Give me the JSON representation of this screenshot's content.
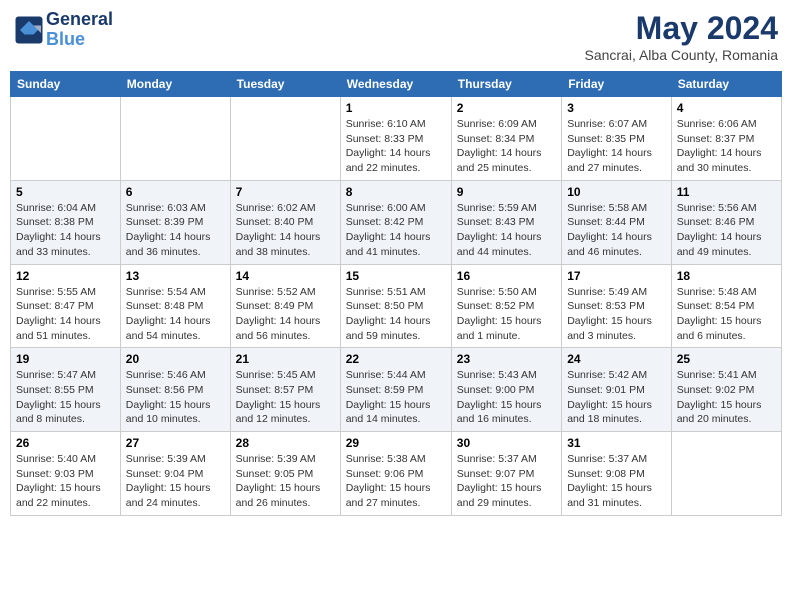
{
  "header": {
    "logo_line1": "General",
    "logo_line2": "Blue",
    "month_year": "May 2024",
    "location": "Sancrai, Alba County, Romania"
  },
  "days_of_week": [
    "Sunday",
    "Monday",
    "Tuesday",
    "Wednesday",
    "Thursday",
    "Friday",
    "Saturday"
  ],
  "weeks": [
    [
      null,
      null,
      null,
      {
        "day": "1",
        "sunrise": "6:10 AM",
        "sunset": "8:33 PM",
        "daylight": "14 hours and 22 minutes."
      },
      {
        "day": "2",
        "sunrise": "6:09 AM",
        "sunset": "8:34 PM",
        "daylight": "14 hours and 25 minutes."
      },
      {
        "day": "3",
        "sunrise": "6:07 AM",
        "sunset": "8:35 PM",
        "daylight": "14 hours and 27 minutes."
      },
      {
        "day": "4",
        "sunrise": "6:06 AM",
        "sunset": "8:37 PM",
        "daylight": "14 hours and 30 minutes."
      }
    ],
    [
      {
        "day": "5",
        "sunrise": "6:04 AM",
        "sunset": "8:38 PM",
        "daylight": "14 hours and 33 minutes."
      },
      {
        "day": "6",
        "sunrise": "6:03 AM",
        "sunset": "8:39 PM",
        "daylight": "14 hours and 36 minutes."
      },
      {
        "day": "7",
        "sunrise": "6:02 AM",
        "sunset": "8:40 PM",
        "daylight": "14 hours and 38 minutes."
      },
      {
        "day": "8",
        "sunrise": "6:00 AM",
        "sunset": "8:42 PM",
        "daylight": "14 hours and 41 minutes."
      },
      {
        "day": "9",
        "sunrise": "5:59 AM",
        "sunset": "8:43 PM",
        "daylight": "14 hours and 44 minutes."
      },
      {
        "day": "10",
        "sunrise": "5:58 AM",
        "sunset": "8:44 PM",
        "daylight": "14 hours and 46 minutes."
      },
      {
        "day": "11",
        "sunrise": "5:56 AM",
        "sunset": "8:46 PM",
        "daylight": "14 hours and 49 minutes."
      }
    ],
    [
      {
        "day": "12",
        "sunrise": "5:55 AM",
        "sunset": "8:47 PM",
        "daylight": "14 hours and 51 minutes."
      },
      {
        "day": "13",
        "sunrise": "5:54 AM",
        "sunset": "8:48 PM",
        "daylight": "14 hours and 54 minutes."
      },
      {
        "day": "14",
        "sunrise": "5:52 AM",
        "sunset": "8:49 PM",
        "daylight": "14 hours and 56 minutes."
      },
      {
        "day": "15",
        "sunrise": "5:51 AM",
        "sunset": "8:50 PM",
        "daylight": "14 hours and 59 minutes."
      },
      {
        "day": "16",
        "sunrise": "5:50 AM",
        "sunset": "8:52 PM",
        "daylight": "15 hours and 1 minute."
      },
      {
        "day": "17",
        "sunrise": "5:49 AM",
        "sunset": "8:53 PM",
        "daylight": "15 hours and 3 minutes."
      },
      {
        "day": "18",
        "sunrise": "5:48 AM",
        "sunset": "8:54 PM",
        "daylight": "15 hours and 6 minutes."
      }
    ],
    [
      {
        "day": "19",
        "sunrise": "5:47 AM",
        "sunset": "8:55 PM",
        "daylight": "15 hours and 8 minutes."
      },
      {
        "day": "20",
        "sunrise": "5:46 AM",
        "sunset": "8:56 PM",
        "daylight": "15 hours and 10 minutes."
      },
      {
        "day": "21",
        "sunrise": "5:45 AM",
        "sunset": "8:57 PM",
        "daylight": "15 hours and 12 minutes."
      },
      {
        "day": "22",
        "sunrise": "5:44 AM",
        "sunset": "8:59 PM",
        "daylight": "15 hours and 14 minutes."
      },
      {
        "day": "23",
        "sunrise": "5:43 AM",
        "sunset": "9:00 PM",
        "daylight": "15 hours and 16 minutes."
      },
      {
        "day": "24",
        "sunrise": "5:42 AM",
        "sunset": "9:01 PM",
        "daylight": "15 hours and 18 minutes."
      },
      {
        "day": "25",
        "sunrise": "5:41 AM",
        "sunset": "9:02 PM",
        "daylight": "15 hours and 20 minutes."
      }
    ],
    [
      {
        "day": "26",
        "sunrise": "5:40 AM",
        "sunset": "9:03 PM",
        "daylight": "15 hours and 22 minutes."
      },
      {
        "day": "27",
        "sunrise": "5:39 AM",
        "sunset": "9:04 PM",
        "daylight": "15 hours and 24 minutes."
      },
      {
        "day": "28",
        "sunrise": "5:39 AM",
        "sunset": "9:05 PM",
        "daylight": "15 hours and 26 minutes."
      },
      {
        "day": "29",
        "sunrise": "5:38 AM",
        "sunset": "9:06 PM",
        "daylight": "15 hours and 27 minutes."
      },
      {
        "day": "30",
        "sunrise": "5:37 AM",
        "sunset": "9:07 PM",
        "daylight": "15 hours and 29 minutes."
      },
      {
        "day": "31",
        "sunrise": "5:37 AM",
        "sunset": "9:08 PM",
        "daylight": "15 hours and 31 minutes."
      },
      null
    ]
  ]
}
